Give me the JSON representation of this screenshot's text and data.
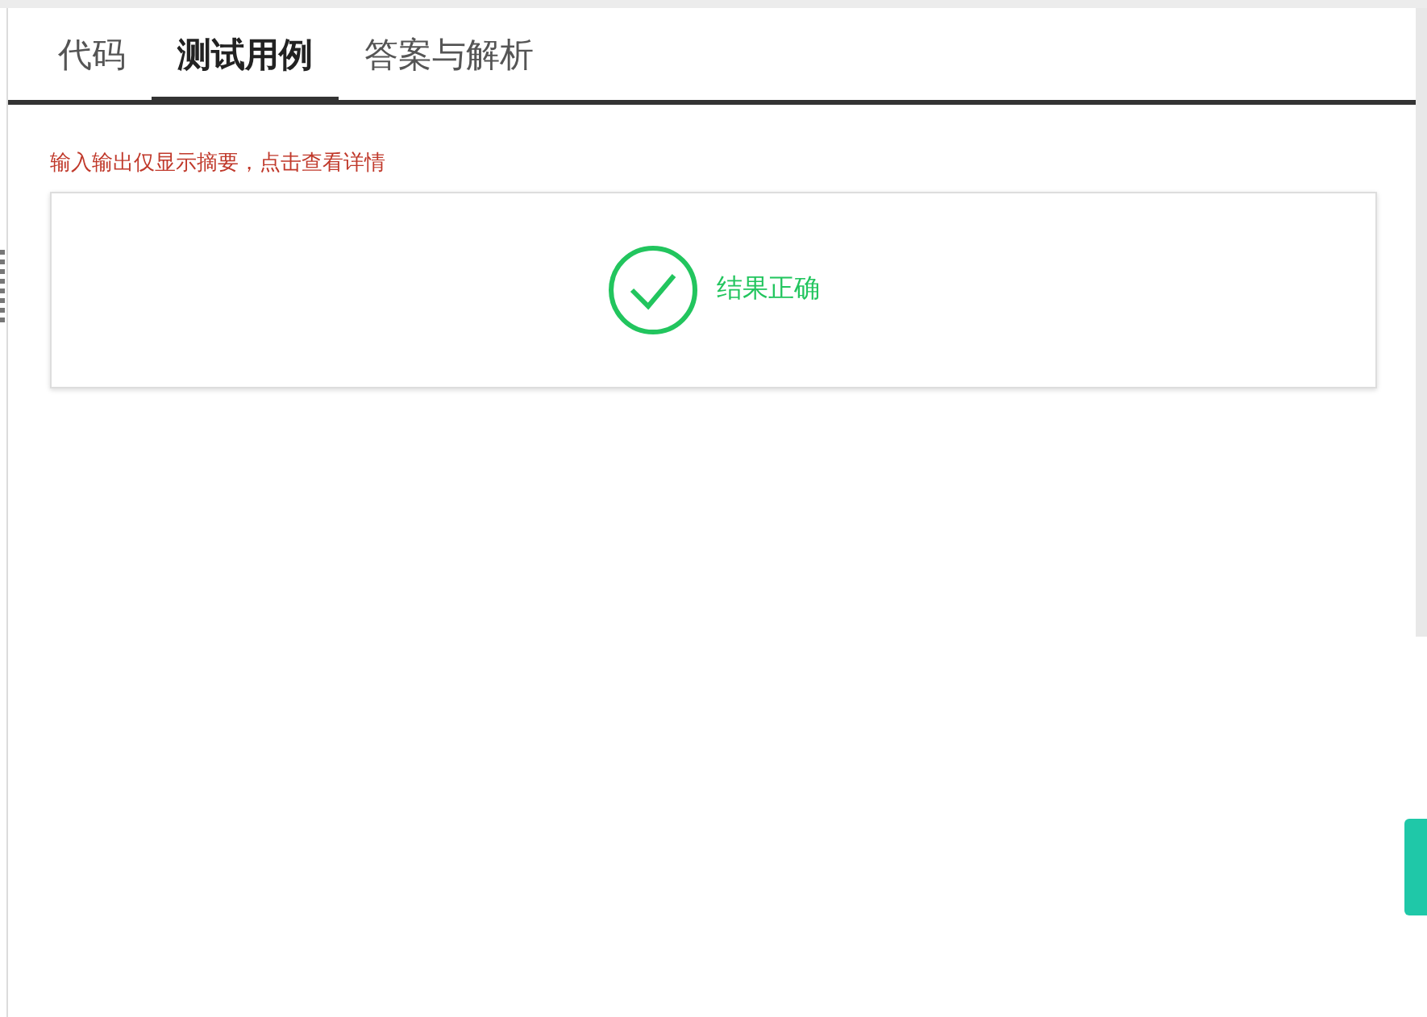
{
  "tabs": [
    {
      "label": "代码",
      "selected": false
    },
    {
      "label": "测试用例",
      "selected": true
    },
    {
      "label": "答案与解析",
      "selected": false
    }
  ],
  "hint": "输入输出仅显示摘要，点击查看详情",
  "result": {
    "correct": true,
    "text": "结果正确"
  }
}
